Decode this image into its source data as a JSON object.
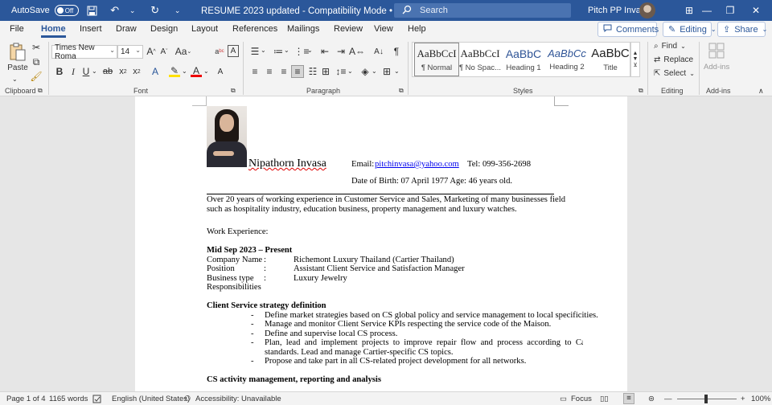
{
  "titlebar": {
    "autosave_label": "AutoSave",
    "autosave_state": "Off",
    "doc_title": "RESUME 2023 updated  -  Compatibility Mode  •  Saved  ∨",
    "search_placeholder": "Search",
    "user_name": "Pitch PP Invasa"
  },
  "tabs": [
    "File",
    "Home",
    "Insert",
    "Draw",
    "Design",
    "Layout",
    "References",
    "Mailings",
    "Review",
    "View",
    "Help"
  ],
  "active_tab": "Home",
  "tab_buttons": {
    "comments": "Comments",
    "editing": "Editing",
    "share": "Share"
  },
  "ribbon": {
    "paste_label": "Paste",
    "font_name": "Times New Roma",
    "font_size": "14",
    "styles": [
      {
        "preview": "AaBbCcI",
        "name": "¶ Normal"
      },
      {
        "preview": "AaBbCcI",
        "name": "¶ No Spac..."
      },
      {
        "preview": "AaBbC",
        "name": "Heading 1"
      },
      {
        "preview": "AaBbCc",
        "name": "Heading 2"
      },
      {
        "preview": "AaBbC",
        "name": "Title"
      }
    ],
    "editing": {
      "find": "Find",
      "replace": "Replace",
      "select": "Select"
    },
    "addins_label": "Add-ins",
    "groups": {
      "clipboard": "Clipboard",
      "font": "Font",
      "paragraph": "Paragraph",
      "styles": "Styles",
      "editing": "Editing",
      "addins": "Add-ins"
    }
  },
  "document": {
    "name": "Nipathorn Invasa",
    "email_label": "Email:",
    "email": "pitchinvasa@yahoo.com",
    "tel": "Tel: 099-356-2698",
    "dob": "Date of Birth: 07 April 1977 Age: 46 years old.",
    "summary_line1": "Over 20 years of working experience in Customer Service and Sales, Marketing of many businesses field",
    "summary_line2": "such as hospitality industry, education business, property management and luxury watches.",
    "work_heading": "Work Experience:",
    "period": "Mid Sep 2023 – Present",
    "fields": [
      {
        "label": "Company Name",
        "colon": ":",
        "value": "Richemont Luxury Thailand (Cartier Thailand)"
      },
      {
        "label": "Position",
        "colon": ":",
        "value": "Assistant Client Service and Satisfaction Manager"
      },
      {
        "label": "Business type",
        "colon": ":",
        "value": "Luxury Jewelry"
      }
    ],
    "responsibilities": "Responsibilities",
    "section1_title": "Client Service strategy definition",
    "bullets": [
      "Define market strategies based on CS global policy and service management to local specificities.",
      "Manage and monitor Client Service KPIs respecting the service code of the Maison.",
      "Define and supervise local CS process.",
      "Plan,  lead  and  implement  projects  to  improve  repair  flow  and  process  according  to  Cartier",
      "standards.  Lead and manage Cartier-specific CS topics.",
      "Propose and take part in all CS-related project development for all networks."
    ],
    "section2_title": "CS activity management, reporting and analysis"
  },
  "statusbar": {
    "page": "Page 1 of 4",
    "words": "1165 words",
    "language": "English (United States)",
    "accessibility": "Accessibility: Unavailable",
    "focus": "Focus",
    "zoom": "100%"
  }
}
